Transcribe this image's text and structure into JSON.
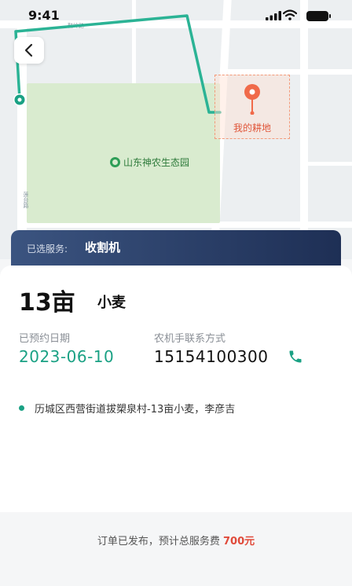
{
  "status_bar": {
    "time": "9:41"
  },
  "map": {
    "park_name": "山东神农生态园",
    "farm_label": "我的耕地",
    "road_label_1": "鞋岭路",
    "road_label_2": "莲台路"
  },
  "service": {
    "label": "已选服务:",
    "value": "收割机"
  },
  "order": {
    "area": "13亩",
    "crop": "小麦",
    "date_label": "已预约日期",
    "date": "2023-06-10",
    "contact_label": "农机手联系方式",
    "phone": "15154100300",
    "address": "历城区西营街道拔槊泉村-13亩小麦，李彦吉"
  },
  "footer": {
    "text": "订单已发布，预计总服务费",
    "fee": "700元"
  },
  "colors": {
    "accent": "#1aa184",
    "fee": "#e04a3a",
    "banner": "#2a3e69",
    "farm": "#f06a4a"
  }
}
